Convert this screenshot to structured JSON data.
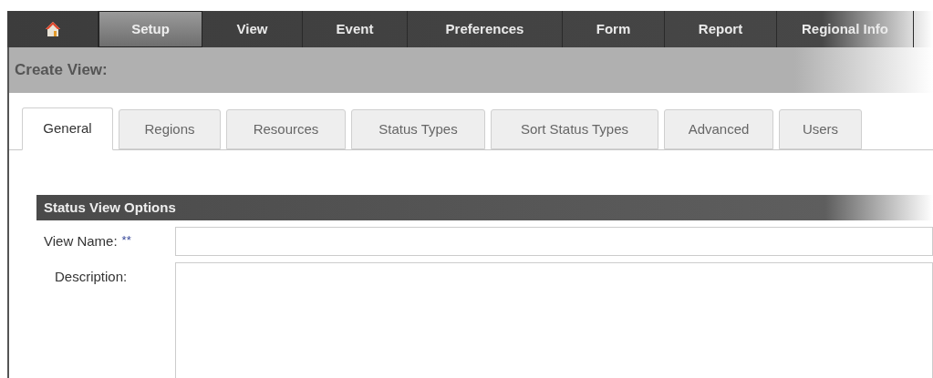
{
  "nav": [
    {
      "kind": "home",
      "selected": false
    },
    {
      "kind": "text",
      "label": "Setup",
      "selected": true
    },
    {
      "kind": "text",
      "label": "View",
      "selected": false
    },
    {
      "kind": "text",
      "label": "Event",
      "selected": false
    },
    {
      "kind": "text",
      "label": "Preferences",
      "selected": false
    },
    {
      "kind": "text",
      "label": "Form",
      "selected": false
    },
    {
      "kind": "text",
      "label": "Report",
      "selected": false
    },
    {
      "kind": "text",
      "label": "Regional Info",
      "selected": false
    }
  ],
  "page_title": "Create View:",
  "tabs": [
    {
      "label": "General",
      "selected": true
    },
    {
      "label": "Regions",
      "selected": false
    },
    {
      "label": "Resources",
      "selected": false
    },
    {
      "label": "Status Types",
      "selected": false
    },
    {
      "label": "Sort Status Types",
      "selected": false
    },
    {
      "label": "Advanced",
      "selected": false
    },
    {
      "label": "Users",
      "selected": false
    }
  ],
  "section": {
    "title": "Status View Options",
    "fields": [
      {
        "kind": "text",
        "label": "View Name:",
        "required": "**"
      },
      {
        "kind": "textarea",
        "label": "Description:"
      }
    ]
  }
}
